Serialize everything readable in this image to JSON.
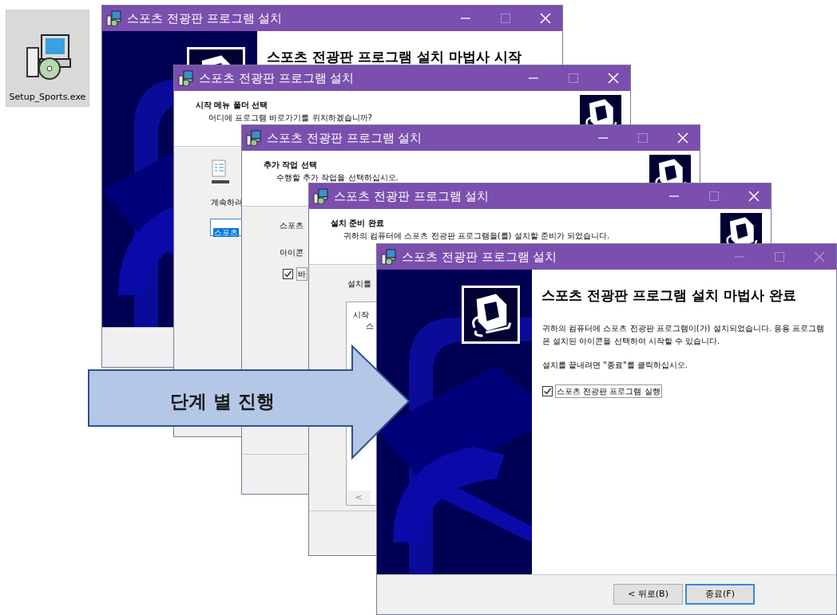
{
  "desktop_icon": {
    "label": "Setup_Sports.exe",
    "selected": true
  },
  "windows": [
    {
      "title": "스포츠 전광판 프로그램 설치",
      "title_buttons_dimmed": false,
      "heading": "스포츠 전광판 프로그램 설치 마법사 시작"
    },
    {
      "title": "스포츠 전광판 프로그램 설치",
      "title_buttons_dimmed": false,
      "heading": "시작 메뉴 폴더 선택",
      "subheading": "어디에 프로그램 바로가기를 위치하겠습니까?",
      "prompt": "계속하려",
      "folder_field": "스포츠"
    },
    {
      "title": "스포츠 전광판 프로그램 설치",
      "title_buttons_dimmed": false,
      "heading": "추가 작업 선택",
      "subheading": "수행할 추가 작업을 선택하십시오.",
      "group_label": "스포츠",
      "section_label": "아이콘",
      "option": {
        "label": "바",
        "checked": true
      }
    },
    {
      "title": "스포츠 전광판 프로그램 설치",
      "title_buttons_dimmed": false,
      "heading": "설치 준비 완료",
      "subheading": "귀하의 컴퓨터에 스포츠 전광판 프로그램을(를) 설치할 준비가 되었습니다.",
      "prompt": "설치를",
      "summary_lines": [
        "시작",
        "스"
      ],
      "scroll_button": "<"
    },
    {
      "title": "스포츠 전광판 프로그램 설치",
      "title_buttons_dimmed": true,
      "heading": "스포츠 전광판 프로그램 설치 마법사 완료",
      "paragraphs": [
        "귀하의 컴퓨터에 스포츠 전광판 프로그램이(가) 설치되었습니다. 응용 프로그램은 설치된 아이콘을 선택하여 시작할 수 있습니다.",
        "설치를 끝내려면 \"종료\"를 클릭하십시오."
      ],
      "option": {
        "label": "스포츠 전광판 프로그램 실행",
        "checked": true
      },
      "buttons": [
        {
          "label": "< 뒤로(B)",
          "default": false
        },
        {
          "label": "종료(F)",
          "default": true
        }
      ]
    }
  ],
  "arrow": {
    "label": "단계 별 진행"
  }
}
